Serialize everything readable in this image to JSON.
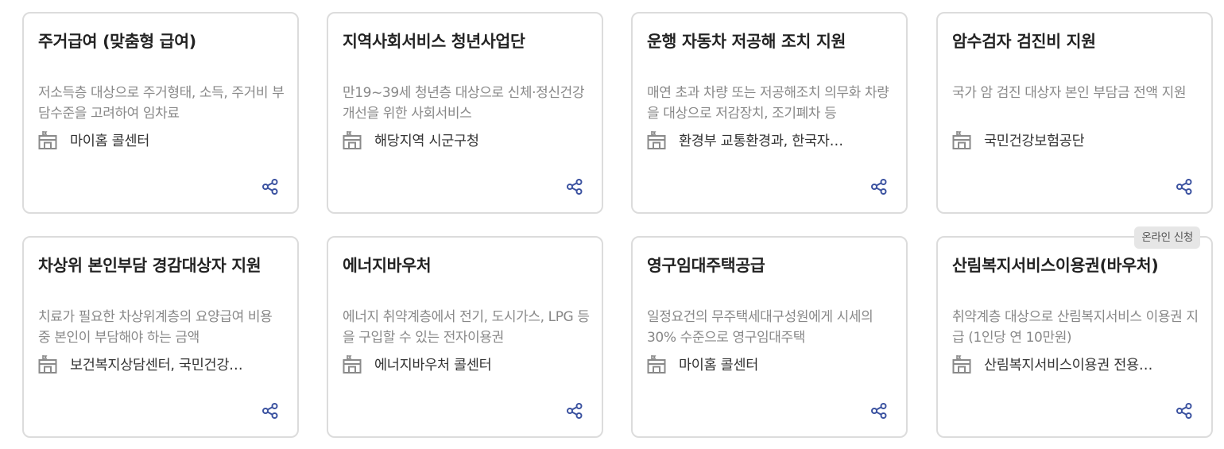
{
  "colors": {
    "share_icon": "#3b52a0",
    "org_icon": "#8a8a8a",
    "card_border": "#dcdcdc",
    "badge_bg": "#e6e6e6"
  },
  "cards": [
    {
      "title": "주거급여 (맞춤형 급여)",
      "description": "저소득층 대상으로 주거형태, 소득, 주거비 부담수준을 고려하여 임차료",
      "org": "마이홈 콜센터",
      "org_icon": "building-icon",
      "share_icon": "share-icon"
    },
    {
      "title": "지역사회서비스 청년사업단",
      "description": "만19~39세 청년층 대상으로 신체·정신건강 개선을 위한 사회서비스",
      "org": "해당지역 시군구청",
      "org_icon": "building-icon",
      "share_icon": "share-icon"
    },
    {
      "title": "운행 자동차 저공해 조치 지원",
      "description": "매연 초과 차량 또는 저공해조치 의무화 차량을 대상으로 저감장치, 조기폐차 등",
      "org": "환경부 교통환경과, 한국자…",
      "org_icon": "building-icon",
      "share_icon": "share-icon"
    },
    {
      "title": "암수검자 검진비 지원",
      "description": "국가 암 검진 대상자 본인 부담금 전액 지원",
      "org": "국민건강보험공단",
      "org_icon": "building-icon",
      "share_icon": "share-icon"
    },
    {
      "title": "차상위 본인부담 경감대상자 지원",
      "description": "치료가 필요한 차상위계층의 요양급여 비용 중 본인이 부담해야 하는 금액",
      "org": "보건복지상담센터, 국민건강…",
      "org_icon": "building-icon",
      "share_icon": "share-icon"
    },
    {
      "title": "에너지바우처",
      "description": "에너지 취약계층에서 전기, 도시가스, LPG 등을 구입할 수 있는 전자이용권",
      "org": "에너지바우처 콜센터",
      "org_icon": "building-icon",
      "share_icon": "share-icon"
    },
    {
      "title": "영구임대주택공급",
      "description": "일정요건의 무주택세대구성원에게 시세의 30% 수준으로 영구임대주택",
      "org": "마이홈 콜센터",
      "org_icon": "building-icon",
      "share_icon": "share-icon"
    },
    {
      "title": "산림복지서비스이용권(바우처)",
      "description": "취약계층 대상으로 산림복지서비스 이용권 지급 (1인당 연 10만원)",
      "org": "산림복지서비스이용권 전용…",
      "org_icon": "building-icon",
      "share_icon": "share-icon",
      "badge": "온라인 신청"
    }
  ]
}
